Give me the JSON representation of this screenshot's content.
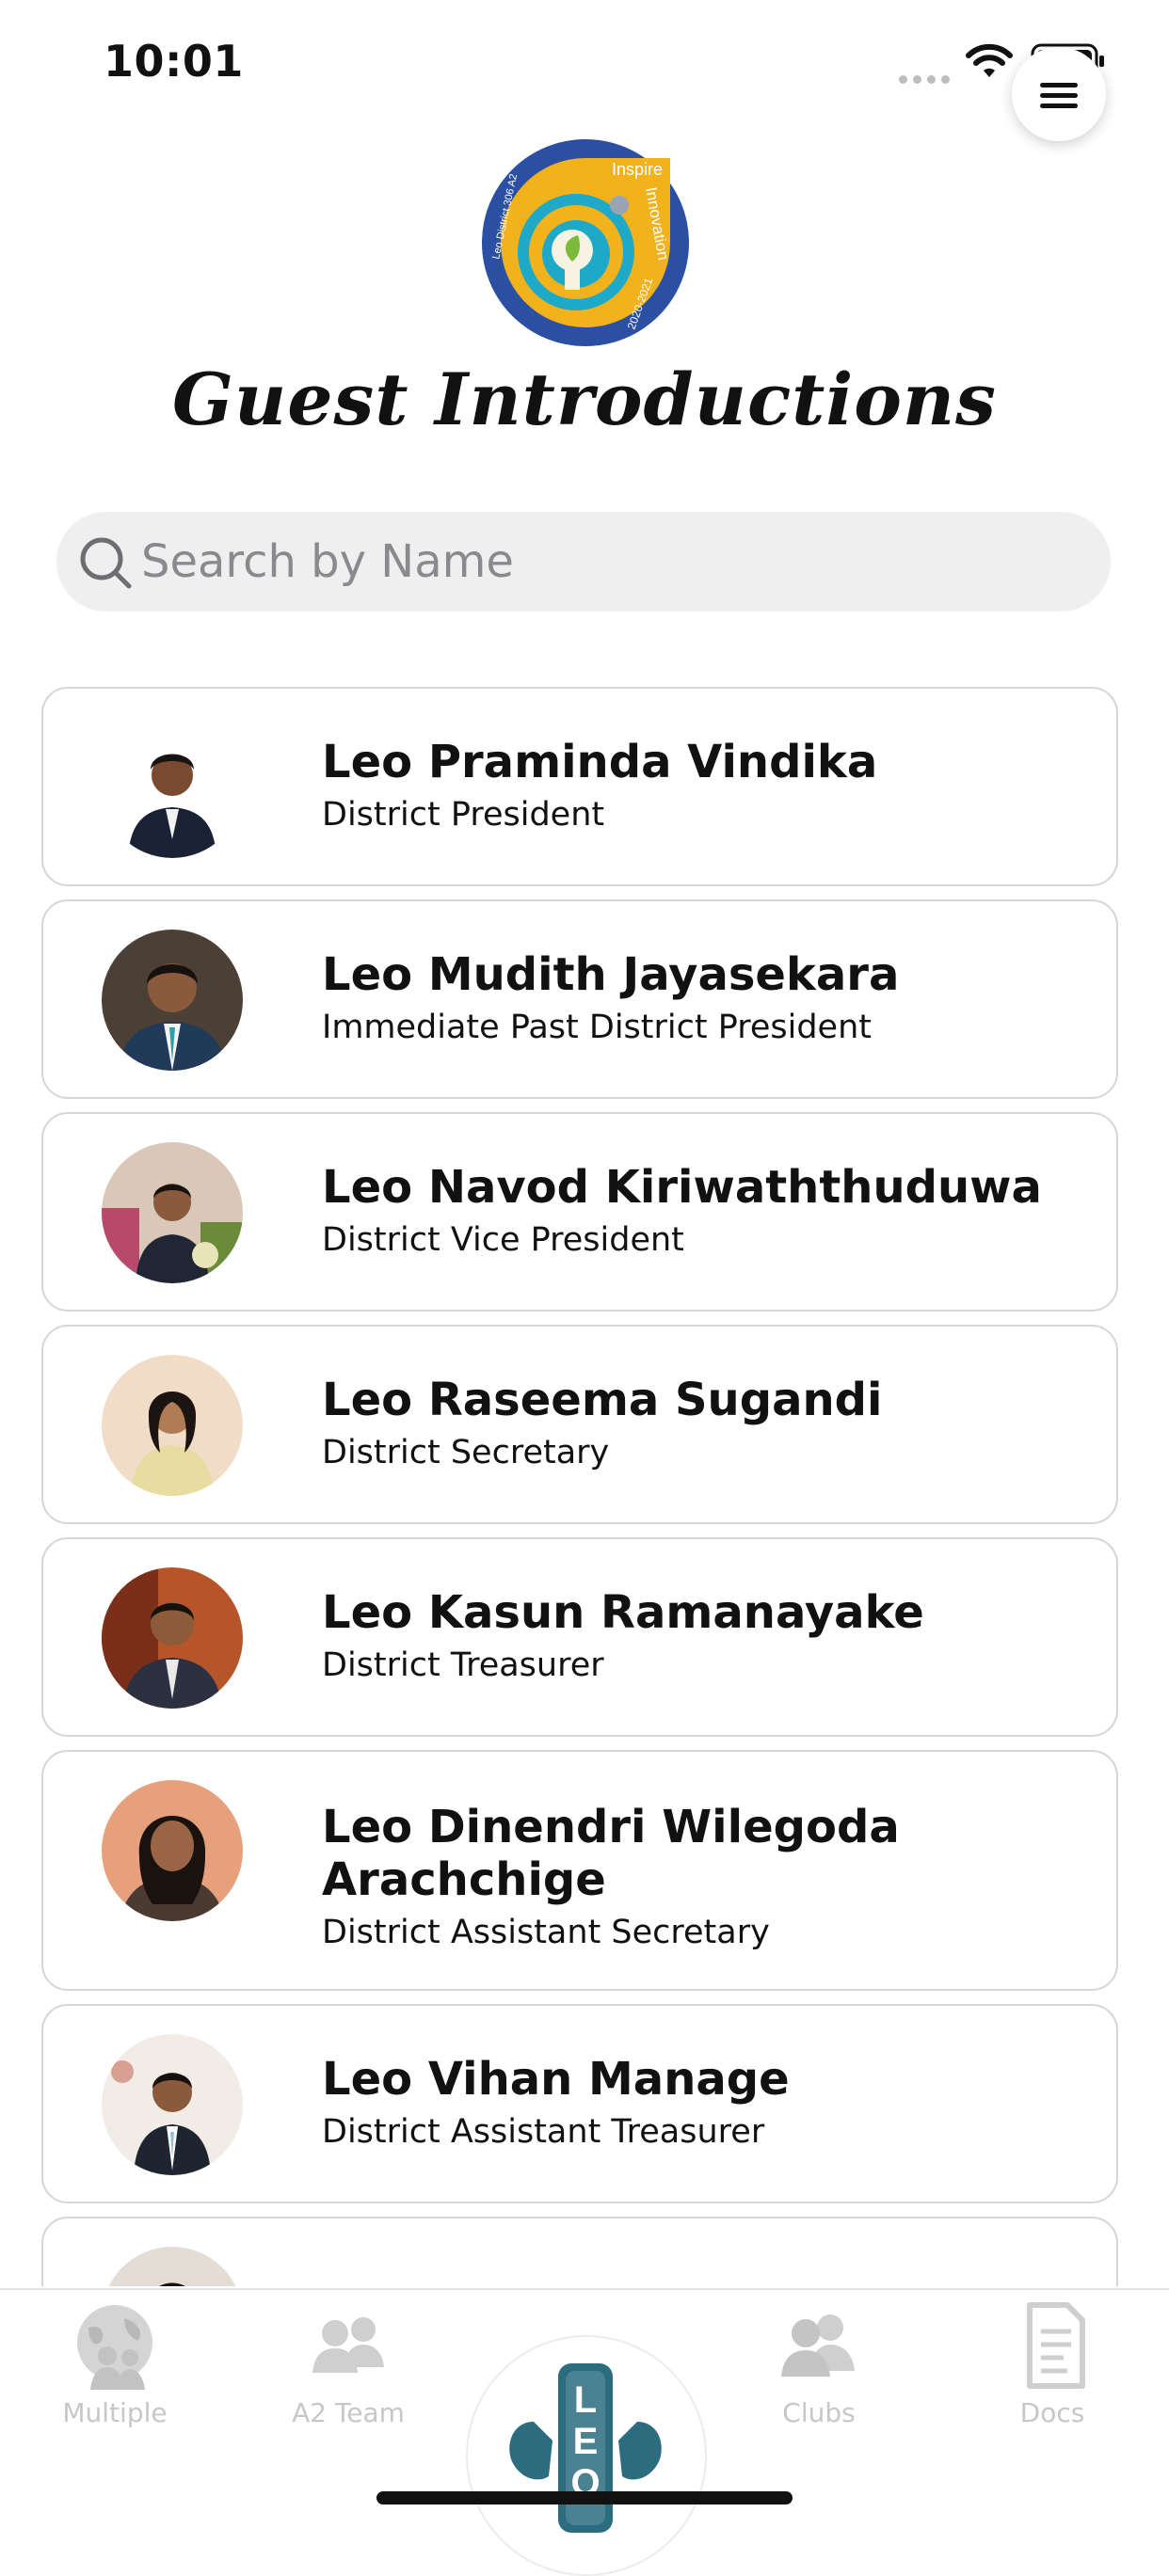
{
  "status_bar": {
    "time": "10:01"
  },
  "header": {
    "logo_text": [
      "Leo District 306 A2",
      "Inspire",
      "Innovation",
      "2020-2021"
    ],
    "title": "Guest Introductions"
  },
  "search": {
    "placeholder": "Search by Name",
    "value": ""
  },
  "guests": [
    {
      "name": "Leo Praminda Vindika",
      "role": "District President"
    },
    {
      "name": "Leo Mudith Jayasekara",
      "role": "Immediate Past District President"
    },
    {
      "name": "Leo Navod Kiriwaththuduwa",
      "role": "District Vice President"
    },
    {
      "name": "Leo Raseema Sugandi",
      "role": "District Secretary"
    },
    {
      "name": "Leo Kasun Ramanayake",
      "role": "District Treasurer"
    },
    {
      "name": "Leo Dinendri Wilegoda Arachchige",
      "role": "District Assistant Secretary"
    },
    {
      "name": "Leo Vihan Manage",
      "role": "District Assistant Treasurer"
    },
    {
      "name": "",
      "role": ""
    }
  ],
  "tabs": [
    {
      "label": "Multiple",
      "icon": "globe-people-icon"
    },
    {
      "label": "A2 Team",
      "icon": "team-icon"
    },
    {
      "label": "",
      "icon": "leo-emblem-icon"
    },
    {
      "label": "Clubs",
      "icon": "group-icon"
    },
    {
      "label": "Docs",
      "icon": "document-icon"
    }
  ],
  "colors": {
    "logo_blue": "#2b4fa2",
    "logo_yellow": "#f2b21b",
    "logo_teal": "#1fa9c8",
    "logo_green": "#7cbb3a",
    "emblem_teal": "#2b6d7f",
    "inactive_tab": "#c7c7c7"
  }
}
